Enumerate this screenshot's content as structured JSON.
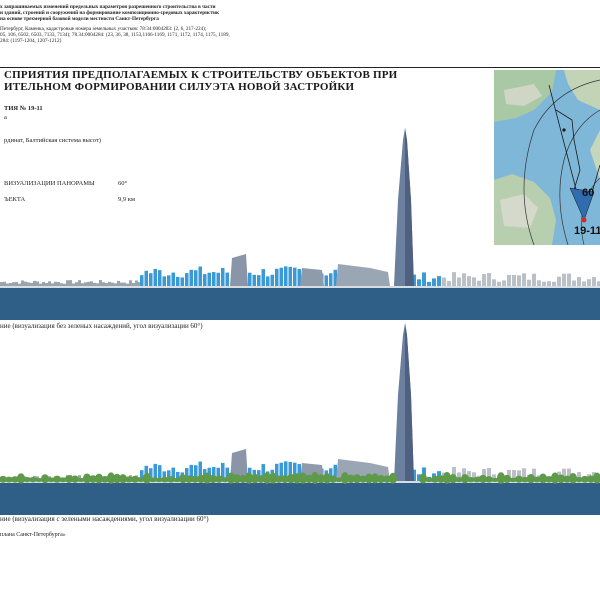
{
  "header": {
    "line1": "х зап­рашиваемых изменений предельных параметров разрешенного строительства в части",
    "line2": "и зданий, строений и сооружений на формирование композиционно-средовых характеристик",
    "line3": "на основе трехмерной базовой модели местности Санкт-Петербурга",
    "line4": "Петербург, Каменка, кадастровые номера земельных участков: 78:34:0004283: (2, 6, 217-224);",
    "line5": "05, 106, 6502, 6503, 7133, 7134); 78.34:0004284: (23, 36, 38, 1153,1166-1169, 1171, 1172, 1174, 1175, 1189,",
    "line6": "284: (1197-1204, 1207-1212)"
  },
  "title": {
    "line1": "СПРИЯТИЯ ПРЕДПОЛАГАЕМЫХ К СТРОИТЕЛЬСТВУ ОБЪЕКТОВ ПРИ",
    "line2": "ИТЕЛЬНОМ ФОРМИРОВАНИИ СИЛУЭТА НОВОЙ ЗАСТРОЙКИ"
  },
  "info": {
    "point_label": "ТИЯ № 19-11",
    "point_sub": "а",
    "coords_note": "рдинат, Балтийская система высот)",
    "angle_label": "ВИЗУАЛИЗАЦИИ ПАНОРАМЫ",
    "angle_value": "60°",
    "distance_label": "ЪЕКТА",
    "distance_value": "9,9 км"
  },
  "map": {
    "angle_label": "60",
    "point_label": "19-11"
  },
  "panorama1": {
    "caption": "ние (визуализация без зеленых насаждений, угол визуализации 60°)"
  },
  "panorama2": {
    "caption": "ние (визуализация с зелеными насаждениями, угол визуализации 60°)"
  },
  "footer": {
    "text": "плана Санкт-Петербурга»"
  },
  "colors": {
    "water": "#2f5e86",
    "tower": "#6b7f9e",
    "buildings_blue": "#3a9ad6",
    "greenery": "#5f9a4a",
    "map_water": "#7fb7d8"
  }
}
